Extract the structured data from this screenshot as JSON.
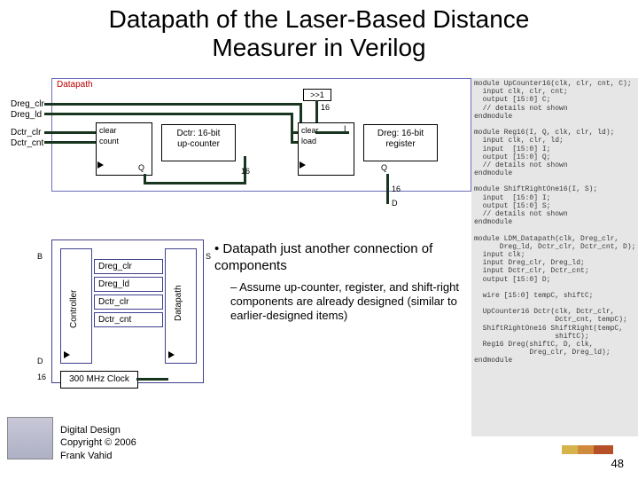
{
  "title_line1": "Datapath of the Laser-Based Distance",
  "title_line2": "Measurer in Verilog",
  "dp_label": "Datapath",
  "sig": {
    "dreg_clr": "Dreg_clr",
    "dreg_ld": "Dreg_ld",
    "dctr_clr": "Dctr_clr",
    "dctr_cnt": "Dctr_cnt"
  },
  "comp": {
    "dctr_clear": "clear",
    "dctr_count": "count",
    "dctr_name": "Dctr: 16-bit\nup-counter",
    "q1": "Q",
    "w16a": "16",
    "dreg_clear": "clear",
    "dreg_load": "load",
    "i_port": "I",
    "dreg_name": "Dreg: 16-bit\nregister",
    "q2": "Q",
    "w16b": "16",
    "d_out": "D",
    "shift": ">>1",
    "shift_w": "16"
  },
  "ctrl": {
    "b": "B",
    "d": "D",
    "sixteen": "16",
    "controller": "Controller",
    "datapath_v": "Datapath",
    "dreg_clr": "Dreg_clr",
    "dreg_ld": "Dreg_ld",
    "dctr_clr": "Dctr_clr",
    "dctr_cnt": "Dctr_cnt",
    "s": "S",
    "clk": "300 MHz Clock"
  },
  "bullets": {
    "main": "Datapath just another connection of components",
    "sub": "– Assume up-counter, register, and shift-right components are already designed (similar to earlier-designed items)"
  },
  "code": "module UpCounter16(clk, clr, cnt, C);\n  input clk, clr, cnt;\n  output [15:0] C;\n  // details not shown\nendmodule\n\nmodule Reg16(I, Q, clk, clr, ld);\n  input clk, clr, ld;\n  input  [15:0] I;\n  output [15:0] Q;\n  // details not shown\nendmodule\n\nmodule ShiftRightOne16(I, S);\n  input  [15:0] I;\n  output [15:0] S;\n  // details not shown\nendmodule\n\nmodule LDM_Datapath(clk, Dreg_clr,\n      Dreg_ld, Dctr_clr, Dctr_cnt, D);\n  input clk;\n  input Dreg_clr, Dreg_ld;\n  input Dctr_clr, Dctr_cnt;\n  output [15:0] D;\n\n  wire [15:0] tempC, shiftC;\n\n  UpCounter16 Dctr(clk, Dctr_clr,\n                   Dctr_cnt, tempC);\n  ShiftRightOne16 ShiftRight(tempC,\n                   shiftC);\n  Reg16 Dreg(shiftC, D, clk,\n             Dreg_clr, Dreg_ld);\nendmodule",
  "footer1": "Digital Design",
  "footer2": "Copyright © 2006",
  "footer3": "Frank Vahid",
  "pagenum": "48"
}
